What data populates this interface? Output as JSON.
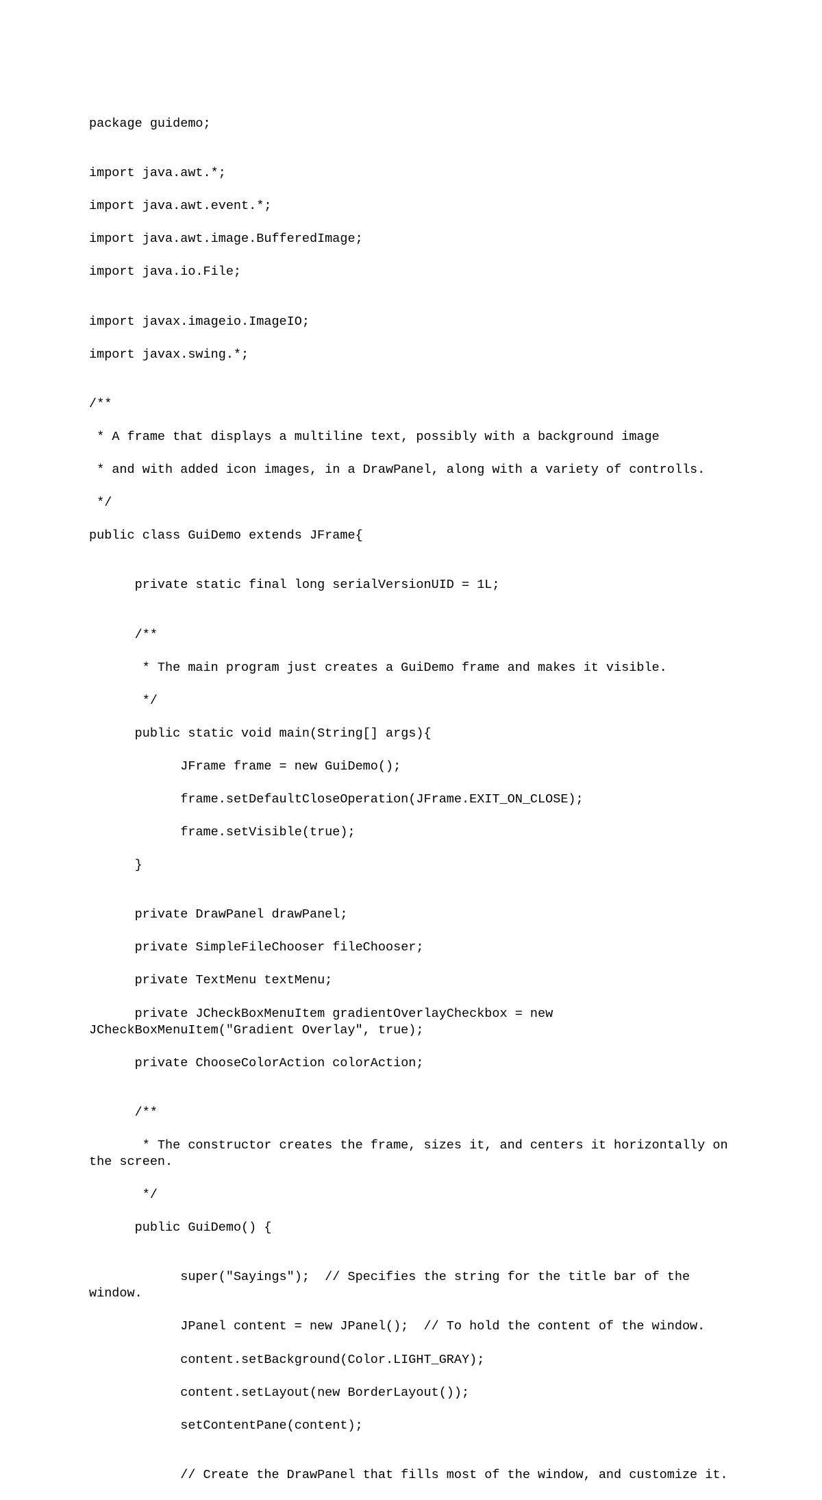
{
  "code": {
    "lines": [
      "package guidemo;",
      "",
      "import java.awt.*;",
      "import java.awt.event.*;",
      "import java.awt.image.BufferedImage;",
      "import java.io.File;",
      "",
      "import javax.imageio.ImageIO;",
      "import javax.swing.*;",
      "",
      "/**",
      " * A frame that displays a multiline text, possibly with a background image",
      " * and with added icon images, in a DrawPanel, along with a variety of controlls.",
      " */",
      "public class GuiDemo extends JFrame{",
      "",
      "      private static final long serialVersionUID = 1L;",
      "",
      "      /**",
      "       * The main program just creates a GuiDemo frame and makes it visible.",
      "       */",
      "      public static void main(String[] args){",
      "            JFrame frame = new GuiDemo();",
      "            frame.setDefaultCloseOperation(JFrame.EXIT_ON_CLOSE);",
      "            frame.setVisible(true);",
      "      }",
      "",
      "      private DrawPanel drawPanel;",
      "      private SimpleFileChooser fileChooser;",
      "      private TextMenu textMenu;",
      "      private JCheckBoxMenuItem gradientOverlayCheckbox = new JCheckBoxMenuItem(\"Gradient Overlay\", true);",
      "      private ChooseColorAction colorAction;",
      "",
      "      /**",
      "       * The constructor creates the frame, sizes it, and centers it horizontally on the screen.",
      "       */",
      "      public GuiDemo() {",
      "",
      "            super(\"Sayings\");  // Specifies the string for the title bar of the window.",
      "            JPanel content = new JPanel();  // To hold the content of the window.",
      "            content.setBackground(Color.LIGHT_GRAY);",
      "            content.setLayout(new BorderLayout());",
      "            setContentPane(content);",
      "",
      "            // Create the DrawPanel that fills most of the window, and customize it."
    ]
  }
}
